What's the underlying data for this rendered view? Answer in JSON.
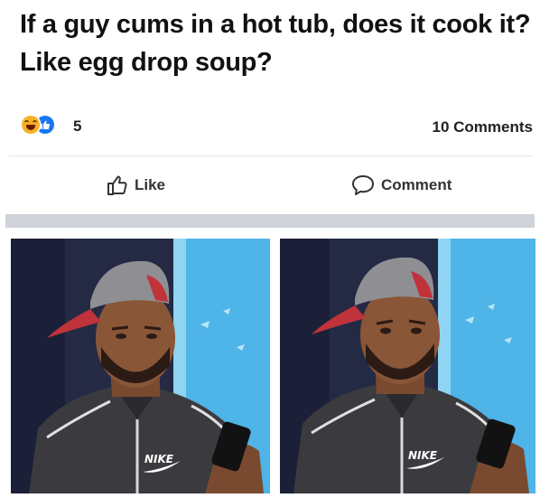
{
  "post": {
    "text": "If a guy cums in a hot tub, does it cook it? Like egg drop soup?"
  },
  "reactions": {
    "icons": [
      "haha-emoji-icon",
      "like-reaction-icon"
    ],
    "count": "5",
    "comments": "10 Comments"
  },
  "actions": {
    "like_label": "Like",
    "comment_label": "Comment"
  },
  "meme_panels": [
    {
      "brand_text": "NIKE"
    },
    {
      "brand_text": "NIKE"
    }
  ],
  "colors": {
    "like_blue": "#1877f2",
    "haha_yellow": "#f7b125",
    "separator_gray": "#cfd3d9"
  }
}
